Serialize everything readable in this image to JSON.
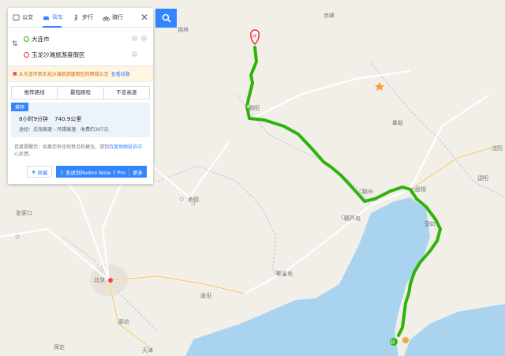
{
  "modes": [
    {
      "label": "公交",
      "icon": "bus-icon"
    },
    {
      "label": "驾车",
      "icon": "car-icon"
    },
    {
      "label": "步行",
      "icon": "walk-icon"
    },
    {
      "label": "骑行",
      "icon": "bike-icon"
    }
  ],
  "active_mode": "驾车",
  "route_inputs": {
    "start": "大连市",
    "end": "玉龙沙滩旅游度假区"
  },
  "notice": {
    "text": "从大连市到玉龙沙滩旅游度假区的跨城公交",
    "link": "查看线路"
  },
  "route_tabs": [
    "推荐路线",
    "最短路程",
    "不走高速"
  ],
  "route": {
    "badge": "推荐",
    "duration": "8小时9分钟",
    "distance": "740.9公里",
    "via": "途经：沈海高速 › 丹锡高速",
    "toll": "收费约307元"
  },
  "feedback": {
    "text": "百度提醒您：如果您有任何意见和建议，请到",
    "link": "百度地图投诉中心",
    "suffix": "反馈。"
  },
  "actions": {
    "fav": "收藏",
    "send": "发送到Redmi Note 7 Pro",
    "more": "更多"
  },
  "map_labels": [
    "北京",
    "天津",
    "承德",
    "唐山",
    "秦皇岛",
    "葫芦岛",
    "锦州",
    "盘锦",
    "营口",
    "阜新",
    "沈阳",
    "辽阳",
    "张家口",
    "保定",
    "廊坊",
    "赤峰",
    "朝阳",
    "锡林"
  ],
  "markers": {
    "start": "起",
    "end": "终"
  },
  "colors": {
    "accent": "#3385ff",
    "route": "#2fb30c",
    "land": "#f1efe8",
    "sea": "#aad3f0"
  }
}
